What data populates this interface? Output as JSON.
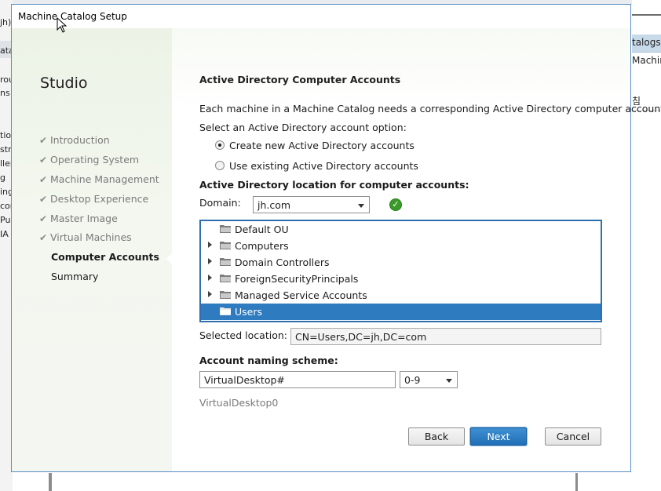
{
  "background": {
    "left_fragments": [
      "jh)",
      "ata",
      "rou",
      "ns",
      "tion",
      "stri",
      "ller",
      "g",
      "ing",
      "con",
      "Pu",
      "IA"
    ],
    "right_fragments": [
      "talogs",
      "Machin",
      "침"
    ]
  },
  "dialog": {
    "title": "Machine Catalog Setup",
    "sidebar": {
      "brand": "Studio",
      "steps": [
        {
          "label": "Introduction",
          "state": "done"
        },
        {
          "label": "Operating System",
          "state": "done"
        },
        {
          "label": "Machine Management",
          "state": "done"
        },
        {
          "label": "Desktop Experience",
          "state": "done"
        },
        {
          "label": "Master Image",
          "state": "done"
        },
        {
          "label": "Virtual Machines",
          "state": "done"
        },
        {
          "label": "Computer Accounts",
          "state": "current"
        },
        {
          "label": "Summary",
          "state": "pending"
        }
      ],
      "check_glyph": "✔"
    },
    "content": {
      "heading": "Active Directory Computer Accounts",
      "description": "Each machine in a Machine Catalog needs a corresponding Active Directory computer account.",
      "option_label": "Select an Active Directory account option:",
      "options": [
        {
          "label": "Create new Active Directory accounts",
          "selected": true
        },
        {
          "label": "Use existing Active Directory accounts",
          "selected": false
        }
      ],
      "location_label": "Active Directory location for computer accounts:",
      "domain_label": "Domain:",
      "domain_value": "jh.com",
      "domain_status_icon": "check-ok-icon",
      "tree_items": [
        {
          "label": "Default OU",
          "expandable": false,
          "selected": false
        },
        {
          "label": "Computers",
          "expandable": true,
          "selected": false
        },
        {
          "label": "Domain Controllers",
          "expandable": true,
          "selected": false
        },
        {
          "label": "ForeignSecurityPrincipals",
          "expandable": true,
          "selected": false
        },
        {
          "label": "Managed Service Accounts",
          "expandable": true,
          "selected": false
        },
        {
          "label": "Users",
          "expandable": false,
          "selected": true
        }
      ],
      "selected_location_label": "Selected location:",
      "selected_location_value": "CN=Users,DC=jh,DC=com",
      "naming_label": "Account naming scheme:",
      "naming_value": "VirtualDesktop#",
      "naming_type": "0-9",
      "naming_preview": "VirtualDesktop0"
    },
    "buttons": {
      "back": "Back",
      "next": "Next",
      "cancel": "Cancel"
    }
  },
  "colors": {
    "accent": "#2e7bbf",
    "sidebar_bg": "#ecf3e6",
    "ok_green": "#3a9a2a"
  }
}
